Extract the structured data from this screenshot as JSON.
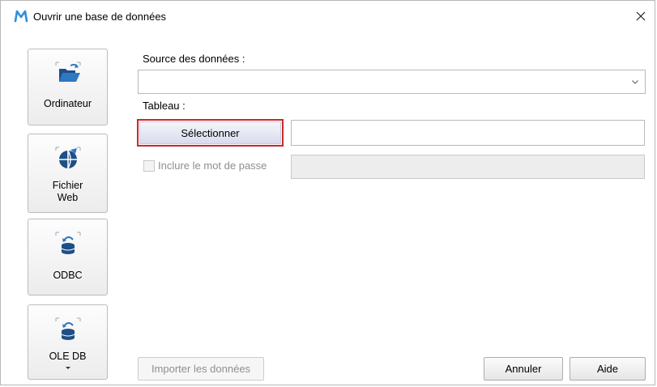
{
  "window": {
    "title": "Ouvrir une base de données",
    "app_icon": "m-logo-icon",
    "close_icon": "close-icon"
  },
  "sources": [
    {
      "label": "Ordinateur",
      "icon": "folder-open-icon"
    },
    {
      "label": "Fichier\nWeb",
      "icon": "web-globe-icon"
    },
    {
      "label": "ODBC",
      "icon": "database-refresh-icon"
    },
    {
      "label": "OLE DB",
      "icon": "database-refresh-icon"
    }
  ],
  "form": {
    "source_label": "Source des données :",
    "source_value": "",
    "table_label": "Tableau :",
    "select_button": "Sélectionner",
    "table_value": "",
    "include_password_label": "Inclure le mot de passe",
    "include_password_checked": false,
    "password_value": ""
  },
  "footer": {
    "import_button": "Importer les données",
    "cancel_button": "Annuler",
    "help_button": "Aide"
  },
  "colors": {
    "accent_logo": "#2f8fd8",
    "select_border": "#c8292a"
  }
}
